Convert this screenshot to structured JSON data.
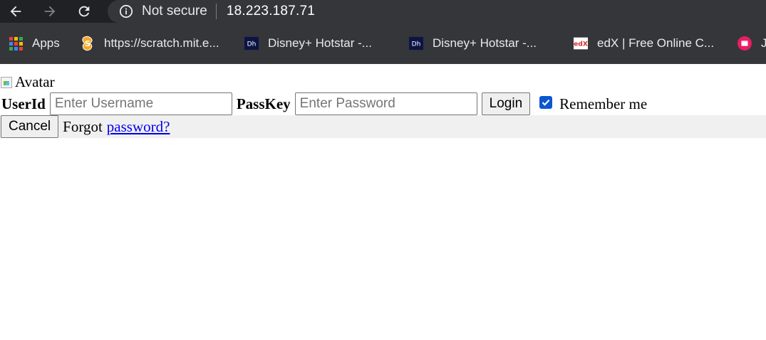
{
  "browser": {
    "security_label": "Not secure",
    "url": "18.223.187.71",
    "bookmarks": [
      {
        "label": "Apps",
        "icon": "apps-grid-icon"
      },
      {
        "label": "https://scratch.mit.e...",
        "icon": "scratch-icon"
      },
      {
        "label": "Disney+ Hotstar -...",
        "icon": "hotstar-icon"
      },
      {
        "label": "Disney+ Hotstar -...",
        "icon": "hotstar-icon"
      },
      {
        "label": "edX | Free Online C...",
        "icon": "edx-icon"
      },
      {
        "label": "J",
        "icon": "calendar-icon"
      }
    ]
  },
  "page": {
    "avatar_alt": "Avatar",
    "userid_label": "UserId",
    "username_placeholder": "Enter Username",
    "passkey_label": "PassKey",
    "password_placeholder": "Enter Password",
    "login_button": "Login",
    "remember_checked": true,
    "remember_label": "Remember me",
    "cancel_button": "Cancel",
    "forgot_text": "Forgot",
    "forgot_link": "password?"
  },
  "colors": {
    "toolbar_bg": "#202124",
    "omnibox_bg": "#35363a",
    "checkbox_accent": "#0b57d0",
    "link": "#0000ee",
    "bottom_bar_bg": "#f0f0f0"
  }
}
